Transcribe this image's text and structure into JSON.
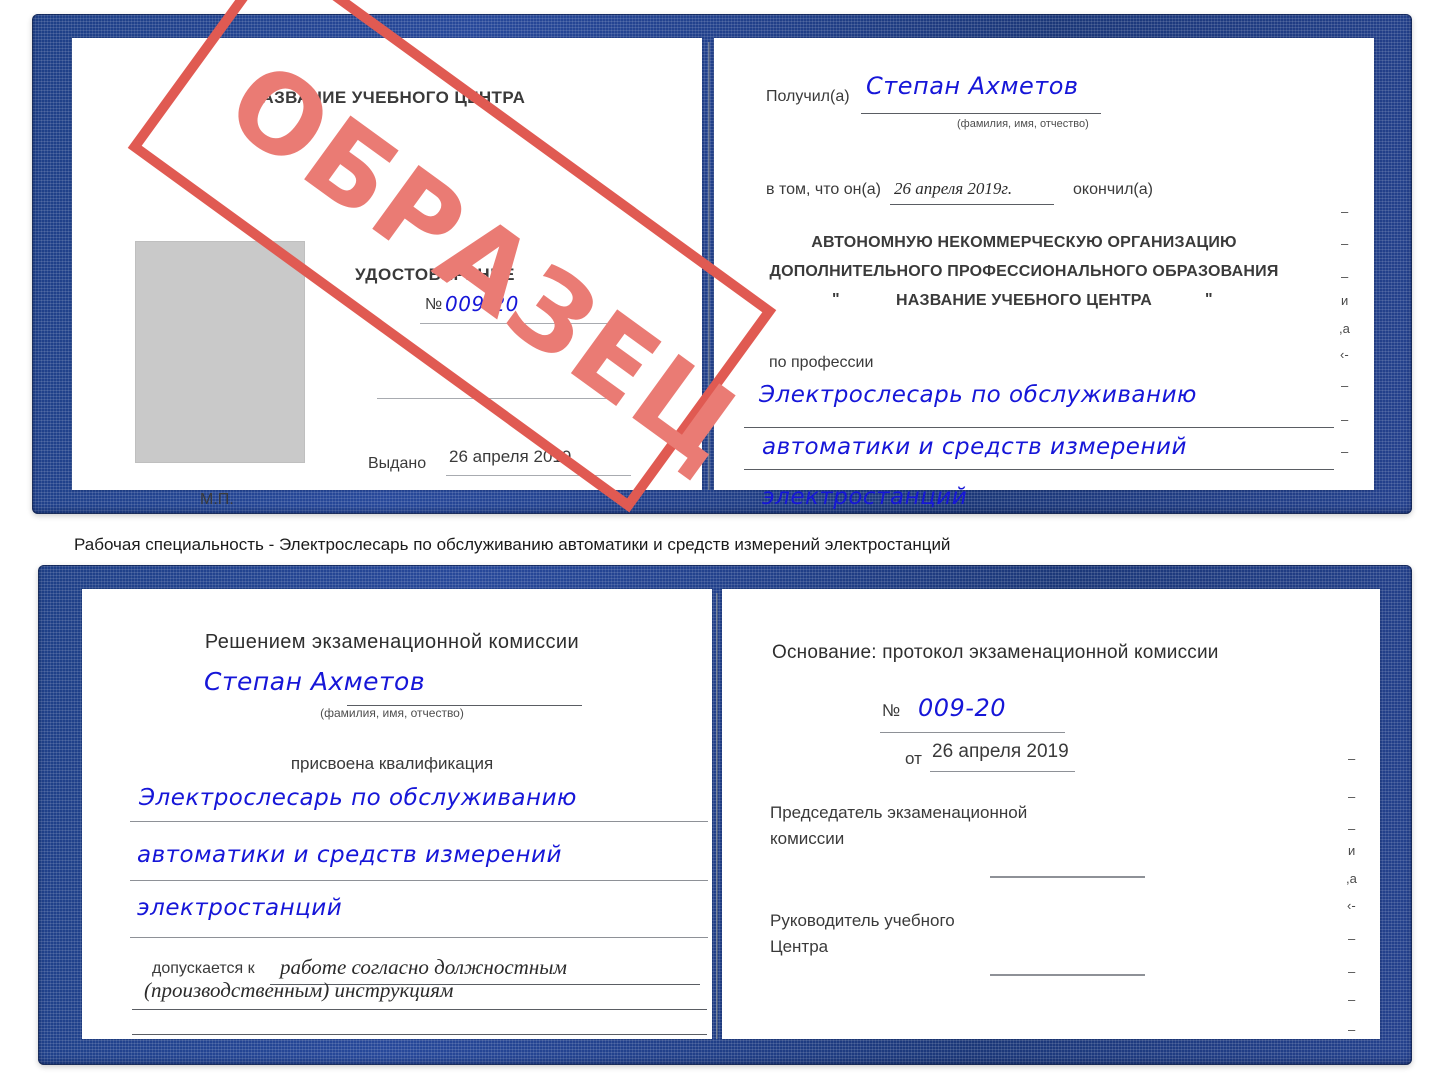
{
  "colors": {
    "cover_blue": "#24418d",
    "handwriting_blue": "#1616d8",
    "stamp_red": "#e05a52",
    "stamp_text_red": "#ea7b74",
    "photo_placeholder_gray": "#c9c9c9",
    "page_white": "#ffffff"
  },
  "watermark": {
    "text": "ОБРАЗЕЦ"
  },
  "certificate_top": {
    "left_page": {
      "header": "НАЗВАНИЕ УЧЕБНОГО ЦЕНТРА",
      "doc_type": "УДОСТОВЕРЕНИЕ",
      "number_prefix": "№",
      "number_value": "009-20",
      "issued_label": "Выдано",
      "issued_value": "26 апреля 2019",
      "stamp_label": "М.П."
    },
    "right_page": {
      "received_label": "Получил(а)",
      "received_value": "Степан Ахметов",
      "name_hint": "(фамилия, имя, отчество)",
      "that_he_label": "в том, что он(а)",
      "that_he_value": "26 апреля 2019г.",
      "graduated_label": "окончил(а)",
      "org_line1": "АВТОНОМНУЮ НЕКОММЕРЧЕСКУЮ ОРГАНИЗАЦИЮ",
      "org_line2": "ДОПОЛНИТЕЛЬНОГО ПРОФЕССИОНАЛЬНОГО ОБРАЗОВАНИЯ",
      "org_quote_open": "\"",
      "org_line3": "НАЗВАНИЕ УЧЕБНОГО ЦЕНТРА",
      "org_quote_close": "\"",
      "profession_label": "по профессии",
      "profession_line1": "Электрослесарь по обслуживанию",
      "profession_line2": "автоматики и средств измерений",
      "profession_line3": "электростанций",
      "margin_fragments": [
        "–",
        "–",
        "–",
        "и",
        ",а",
        "‹-",
        "–",
        "–",
        "–"
      ]
    }
  },
  "caption": {
    "text": "Рабочая специальность - Электрослесарь по обслуживанию автоматики и средств измерений электростанций"
  },
  "certificate_bottom": {
    "left_page": {
      "header": "Решением экзаменационной комиссии",
      "name_value": "Степан Ахметов",
      "name_hint": "(фамилия, имя, отчество)",
      "qualification_label": "присвоена квалификация",
      "qualification_line1": "Электрослесарь по обслуживанию",
      "qualification_line2": "автоматики и средств измерений",
      "qualification_line3": "электростанций",
      "admitted_label": "допускается к",
      "admitted_line1": "работе согласно должностным",
      "admitted_line2": "(производственным) инструкциям"
    },
    "right_page": {
      "basis_label": "Основание: протокол экзаменационной комиссии",
      "number_prefix": "№",
      "number_value": "009-20",
      "date_prefix": "от",
      "date_value": "26 апреля 2019",
      "chairman_line1": "Председатель экзаменационной",
      "chairman_line2": "комиссии",
      "head_line1": "Руководитель учебного",
      "head_line2": "Центра",
      "margin_fragments": [
        "–",
        "–",
        "–",
        "и",
        ",а",
        "‹-",
        "–",
        "–",
        "–",
        "–"
      ]
    }
  }
}
